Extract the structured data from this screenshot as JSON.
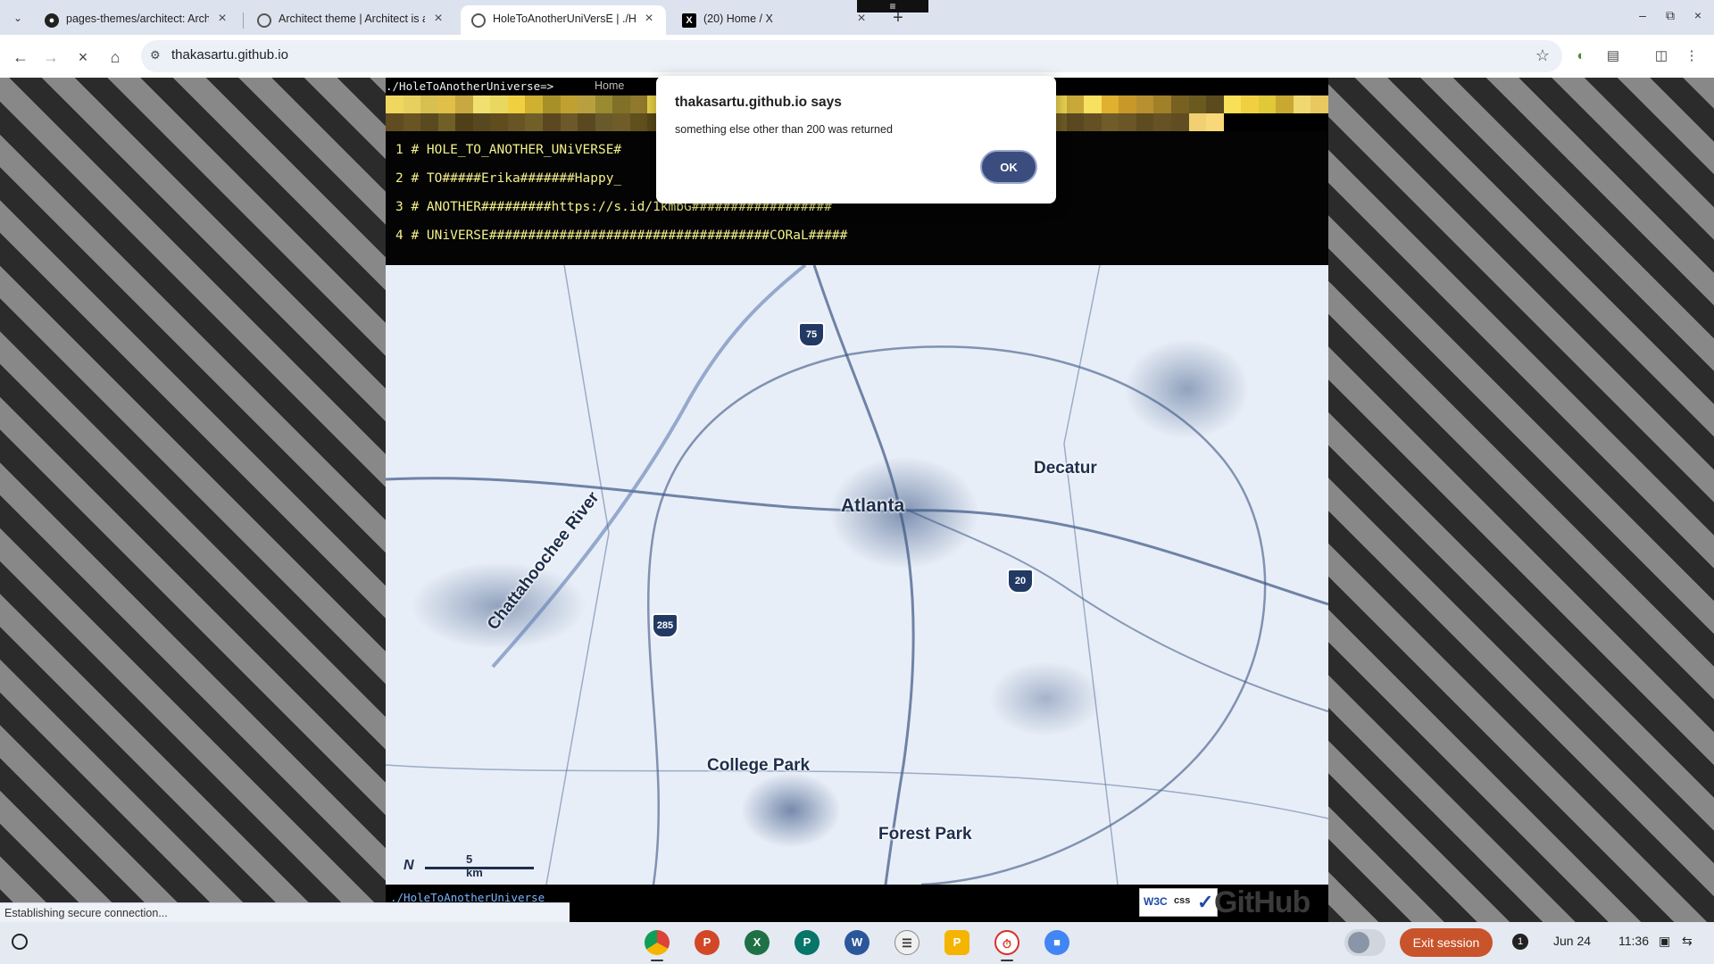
{
  "tabs": [
    {
      "title": "pages-themes/architect: Archit",
      "icon": "github-icon"
    },
    {
      "title": "Architect theme | Architect is a",
      "icon": "globe-icon"
    },
    {
      "title": "HoleToAnotherUniVersE | ./Hol",
      "icon": "site-icon",
      "active": true
    },
    {
      "title": "(20) Home / X",
      "icon": "x-logo-icon"
    }
  ],
  "address_bar": {
    "url": "thakasartu.github.io"
  },
  "site": {
    "title": "./HoleToAnotherUniverse=>",
    "nav_home": "Home",
    "code_lines": [
      "1 # HOLE_TO_ANOTHER_UNiVERSE#",
      "2 # TO#####Erika#######Happy_",
      "3 # ANOTHER#########https://s.id/1kmbG##################",
      "4 # UNiVERSE####################################CORaL#####"
    ],
    "mosaic_colors": [
      "#f0d860",
      "#e8d060",
      "#d8c050",
      "#e0c048",
      "#c8a840",
      "#f0e070",
      "#e8d860",
      "#f0d040",
      "#d0b030",
      "#a89028",
      "#c0a030",
      "#b8a040",
      "#9a8a30",
      "#807028",
      "#90782c",
      "#e8d048",
      "#f0d860",
      "#c0a838",
      "#a08830",
      "#887430",
      "#e0c040",
      "#f0d858",
      "#d8b840",
      "#c8a830",
      "#b89830",
      "#b09830",
      "#e8c840",
      "#f0d048",
      "#c8a030",
      "#b89028",
      "#a08028",
      "#e0b838",
      "#f8d848",
      "#f0d050",
      "#d8b838",
      "#b89030",
      "#a08028",
      "#806828",
      "#e8d050",
      "#c8a838",
      "#f8e060",
      "#e0b030",
      "#c89828",
      "#b89030",
      "#a08028",
      "#786020",
      "#6a5a20",
      "#5a4a1c",
      "#f8e058",
      "#f0d040",
      "#e0c838",
      "#c8a830",
      "#f0d870",
      "#e8c860",
      "#604c20",
      "#6a5424",
      "#5a4a20",
      "#706028",
      "#504018",
      "#584820",
      "#604c1c",
      "#685424",
      "#706028",
      "#5c4820",
      "#6c5828",
      "#5a4820",
      "#685a2a",
      "#705c28",
      "#60501e",
      "#584818",
      "#6c5a26",
      "#6a5624",
      "#5e4a1e",
      "#685424",
      "#60501e",
      "#6a5826",
      "#705c2a",
      "#5c4a20",
      "#644e1e",
      "#6e5a26",
      "#725e2a",
      "#5a4820",
      "#665224",
      "#604e22",
      "#6c5828",
      "#6a5626",
      "#5e4c20",
      "#645022",
      "#705c28",
      "#6a5626",
      "#5c4820",
      "#665224",
      "#6e5a26",
      "#5a4820",
      "#645022",
      "#705c28",
      "#6a5626",
      "#5e4c20",
      "#665224",
      "#604e22",
      "#f0d070",
      "#f8d878"
    ],
    "footer_link": "./HoleToAnotherUniverse",
    "badge_w3c": "W3C",
    "badge_css": "css",
    "footer_brand": "GitHub"
  },
  "map": {
    "labels": [
      "Atlanta",
      "Decatur",
      "Chattahoochee River",
      "College Park",
      "Forest Park"
    ],
    "shields": [
      "75",
      "20",
      "285"
    ],
    "scale": "5 km",
    "north": "N"
  },
  "status_text": "Establishing secure connection...",
  "dialog": {
    "title": "thakasartu.github.io says",
    "message": "something else other than 200 was returned",
    "ok_label": "OK"
  },
  "shelf": {
    "apps": [
      "chrome-icon",
      "powerpoint-icon",
      "excel-icon",
      "publisher-icon",
      "word-icon",
      "docs-icon",
      "keep-icon",
      "timer-icon",
      "files-icon"
    ],
    "exit_label": "Exit session",
    "notification_count": "1",
    "date": "Jun 24",
    "time": "11:36"
  }
}
